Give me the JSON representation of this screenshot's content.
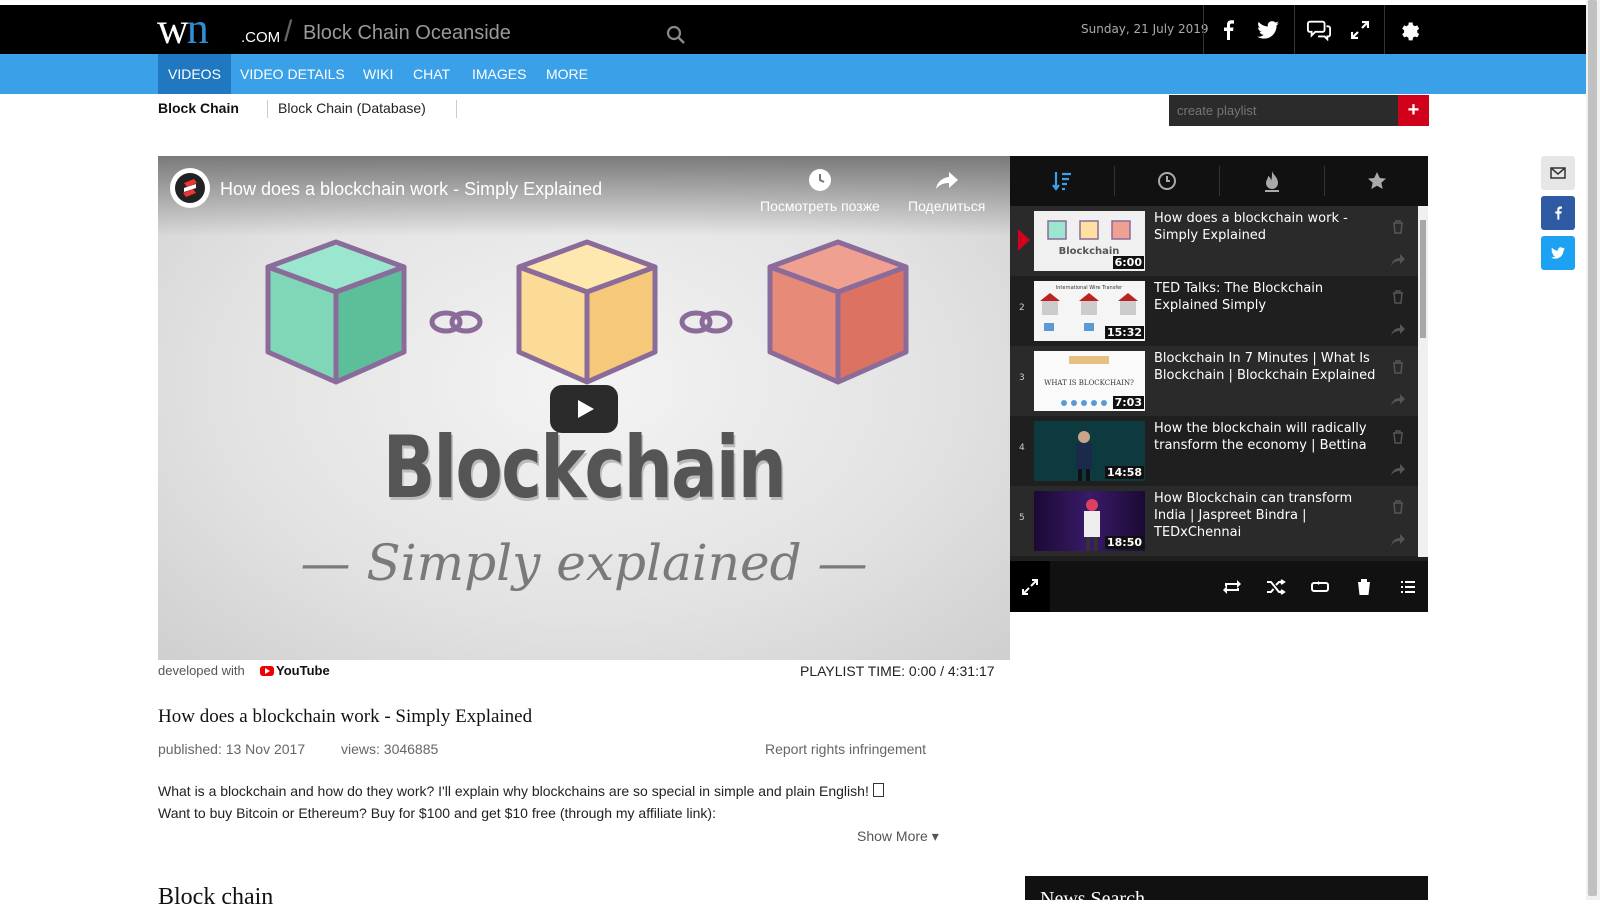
{
  "header": {
    "logo_main": "w",
    "logo_n": "n",
    "logo_com": ".COM",
    "site_title": "Block Chain Oceanside",
    "date": "Sunday, 21 July 2019"
  },
  "nav": [
    "VIDEOS",
    "VIDEO DETAILS",
    "WIKI",
    "CHAT",
    "IMAGES",
    "MORE"
  ],
  "breadcrumbs": [
    "Block Chain",
    "Block Chain (Database)"
  ],
  "playlist_input_placeholder": "create playlist",
  "playlist_add_label": "+",
  "video": {
    "title": "How does a blockchain work - Simply Explained",
    "watch_later": "Посмотреть позже",
    "share": "Поделиться",
    "big_word": "Blockchain",
    "script_line": "— Simply explained —"
  },
  "playlist": [
    {
      "num": "",
      "title": "How does a blockchain work - Simply Explained",
      "duration": "6:00",
      "active": true
    },
    {
      "num": "2",
      "title": "TED Talks: The Blockchain Explained Simply",
      "duration": "15:32"
    },
    {
      "num": "3",
      "title": "Blockchain In 7 Minutes | What Is Blockchain | Blockchain Explained",
      "duration": "7:03"
    },
    {
      "num": "4",
      "title": "How the blockchain will radically transform the economy | Bettina",
      "duration": "14:58"
    },
    {
      "num": "5",
      "title": "How Blockchain can transform India | Jaspreet Bindra | TEDxChennai",
      "duration": "18:50"
    }
  ],
  "thumb_text": {
    "t1": "Blockchain",
    "t2": "International Wire Transfer",
    "t3": "WHAT IS BLOCKCHAIN?"
  },
  "below_video": {
    "developed_with": "developed with",
    "youtube": "YouTube",
    "playlist_time": "PLAYLIST TIME: 0:00 / 4:31:17"
  },
  "details": {
    "title": "How does a blockchain work - Simply Explained",
    "published": "published: 13 Nov 2017",
    "views": "views: 3046885",
    "report": "Report rights infringement",
    "desc_line1": "What is a blockchain and how do they work? I'll explain why blockchains are so special in simple and plain English! ",
    "desc_line2": "Want to buy Bitcoin or Ethereum? Buy for $100 and get $10 free (through my affiliate link):",
    "show_more": "Show More ▾"
  },
  "bottom": {
    "heading": "Block chain",
    "right_heading": "News Search"
  },
  "colors": {
    "topbar": "#000000",
    "navbar": "#3aa0e8",
    "nav_active": "#2079c0",
    "accent_red": "#d0021b",
    "facebook": "#2d5aa3",
    "twitter": "#1da1f2"
  },
  "icons": [
    "search-icon",
    "facebook-icon",
    "twitter-icon",
    "chat-icon",
    "fullscreen-icon",
    "gear-icon",
    "clock-icon",
    "share-icon",
    "sort-icon",
    "fire-icon",
    "star-icon",
    "trash-icon",
    "repeat-icon",
    "shuffle-icon",
    "loop-icon",
    "list-icon",
    "mail-icon"
  ]
}
